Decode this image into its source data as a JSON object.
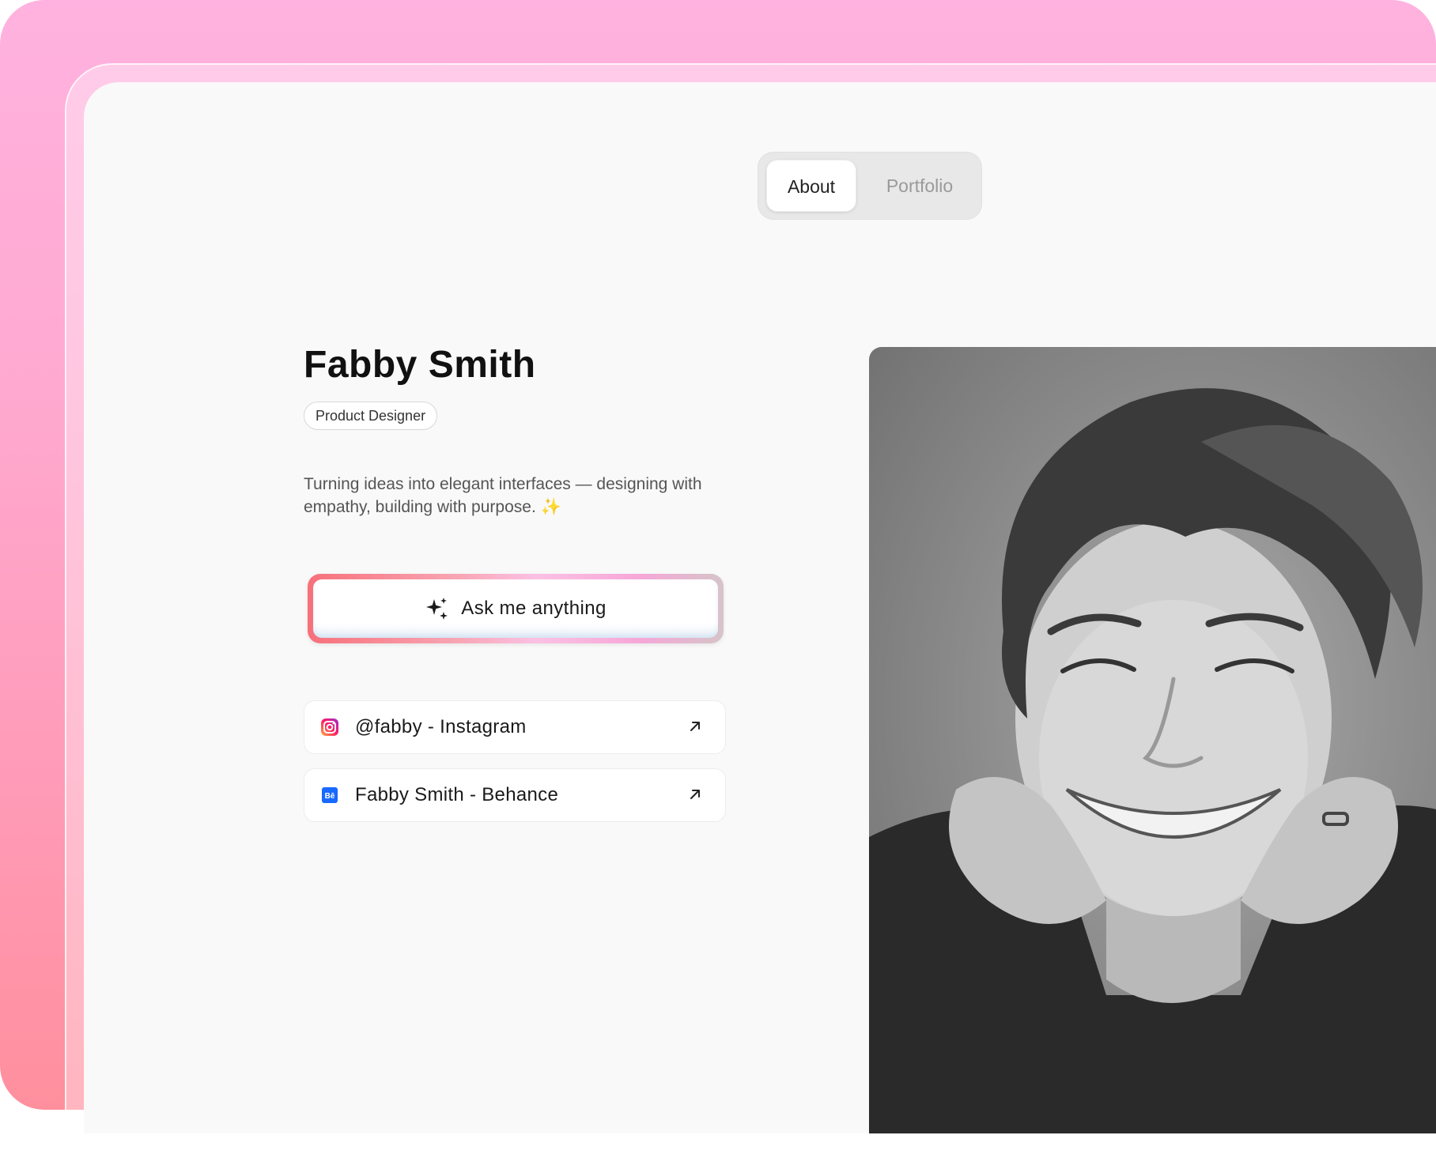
{
  "tabs": [
    {
      "label": "About",
      "active": true
    },
    {
      "label": "Portfolio",
      "active": false
    }
  ],
  "profile": {
    "name": "Fabby Smith",
    "role": "Product Designer",
    "bio": "Turning ideas into elegant interfaces — designing with empathy, building with purpose.",
    "bio_emoji": "✨"
  },
  "ask_button": {
    "label": "Ask me anything",
    "icon": "sparkles-icon"
  },
  "links": [
    {
      "label": "@fabby - Instagram",
      "icon": "instagram-icon"
    },
    {
      "label": "Fabby Smith - Behance",
      "icon": "behance-icon"
    }
  ],
  "photo": {
    "description_icon": "portrait-photo"
  },
  "colors": {
    "background_top": "#ffb2df",
    "background_bottom": "#ff8f9d",
    "screen": "#f9f9f9",
    "behance_blue": "#1769ff"
  }
}
